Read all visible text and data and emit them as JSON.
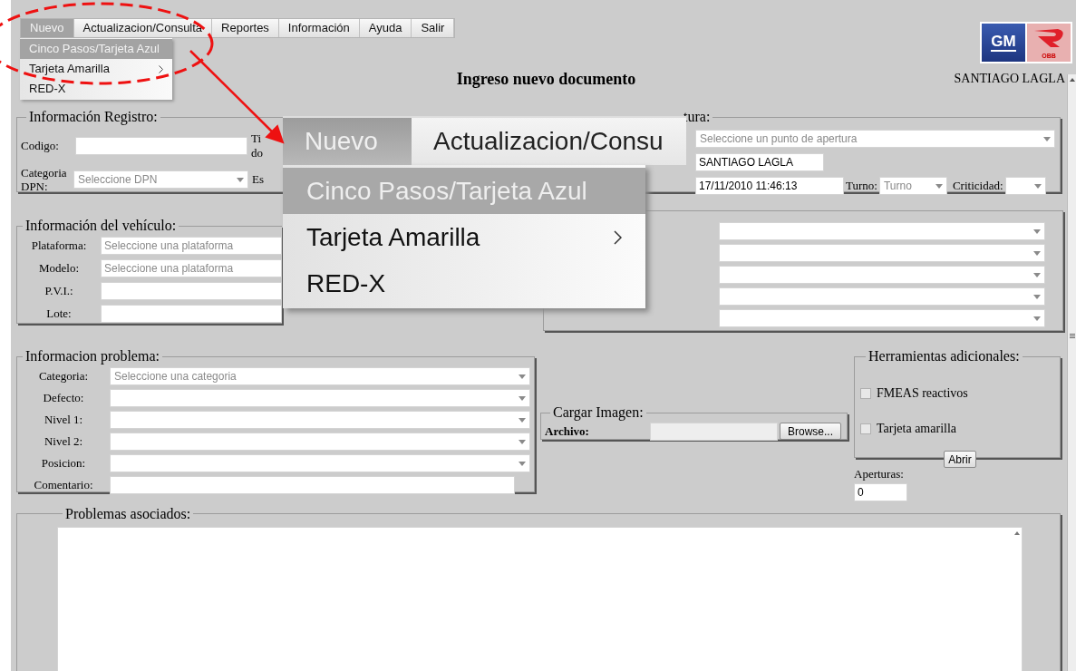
{
  "menu_bar": [
    {
      "label": "Nuevo",
      "selected": true
    },
    {
      "label": "Actualizacion/Consulta",
      "selected": false
    },
    {
      "label": "Reportes",
      "selected": false
    },
    {
      "label": "Información",
      "selected": false
    },
    {
      "label": "Ayuda",
      "selected": false
    },
    {
      "label": "Salir",
      "selected": false
    }
  ],
  "dropdown": [
    {
      "label": "Cinco Pasos/Tarjeta Azul",
      "selected": true,
      "has_submenu": false
    },
    {
      "label": "Tarjeta Amarilla",
      "selected": false,
      "has_submenu": true
    },
    {
      "label": "RED-X",
      "selected": false,
      "has_submenu": false
    }
  ],
  "logo": {
    "left_text": "GM",
    "right_text": "OBB"
  },
  "header": {
    "title": "Ingreso nuevo documento",
    "user": "SANTIAGO LAGLA"
  },
  "registro": {
    "legend": "Información Registro:",
    "codigo_label": "Codigo:",
    "tipo_label": [
      "Ti",
      "do"
    ],
    "categoria_label": "Categoria DPN:",
    "categoria_placeholder": "Seleccione DPN",
    "estado_label": "Es"
  },
  "apertura": {
    "legend": "tura:",
    "punto_placeholder": "Seleccione un punto de apertura",
    "inspector_value": "SANTIAGO LAGLA",
    "fecha_value": "17/11/2010 11:46:13",
    "turno_label": "Turno:",
    "turno_placeholder": "Turno",
    "criticidad_label": "Criticidad:"
  },
  "vehiculo": {
    "legend": "Información del vehículo:",
    "fields": [
      {
        "label": "Plataforma:",
        "kind": "select",
        "placeholder": "Seleccione una plataforma"
      },
      {
        "label": "Modelo:",
        "kind": "select",
        "placeholder": "Seleccione una plataforma"
      },
      {
        "label": "P.V.I.:",
        "kind": "text"
      },
      {
        "label": "Lote:",
        "kind": "text"
      }
    ]
  },
  "problema": {
    "legend": "Informacion problema:",
    "fields": [
      {
        "label": "Categoria:",
        "kind": "select",
        "placeholder": "Seleccione una categoria"
      },
      {
        "label": "Defecto:",
        "kind": "select"
      },
      {
        "label": "Nivel 1:",
        "kind": "select"
      },
      {
        "label": "Nivel 2:",
        "kind": "select"
      },
      {
        "label": "Posicion:",
        "kind": "select"
      },
      {
        "label": "Comentario:",
        "kind": "text"
      }
    ]
  },
  "imagen": {
    "legend": "Cargar Imagen:",
    "archivo_label": "Archivo:",
    "browse_button": "Browse..."
  },
  "herramientas": {
    "legend": "Herramientas adicionales:",
    "options": [
      {
        "label": "FMEAS reactivos",
        "checked": false
      },
      {
        "label": "Tarjeta amarilla",
        "checked": false
      }
    ],
    "button": "Abrir"
  },
  "aperturas": {
    "label": "Aperturas:",
    "value": "0"
  },
  "asociados": {
    "legend": "Problemas asociados:"
  },
  "callout": {
    "menu": [
      {
        "label": "Nuevo",
        "selected": true
      },
      {
        "label": "Actualizacion/Consu",
        "selected": false
      }
    ],
    "items": [
      {
        "label": "Cinco Pasos/Tarjeta Azul",
        "selected": true,
        "has_submenu": false
      },
      {
        "label": "Tarjeta Amarilla",
        "selected": false,
        "has_submenu": true
      },
      {
        "label": "RED-X",
        "selected": false,
        "has_submenu": false
      }
    ]
  }
}
